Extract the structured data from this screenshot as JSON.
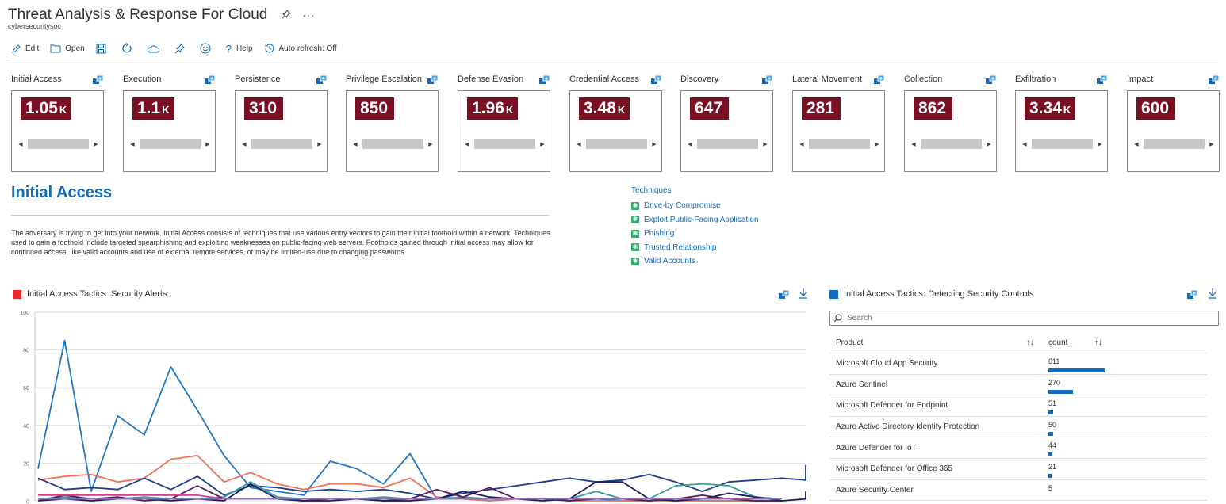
{
  "header": {
    "title": "Threat Analysis & Response For Cloud",
    "subtitle": "cybersecuritysoc",
    "more": "···"
  },
  "toolbar": {
    "edit": "Edit",
    "open": "Open",
    "help": "Help",
    "auto_refresh": "Auto refresh: Off"
  },
  "tiles": [
    {
      "label": "Initial Access",
      "value": "1.05",
      "suffix": "K"
    },
    {
      "label": "Execution",
      "value": "1.1",
      "suffix": "K"
    },
    {
      "label": "Persistence",
      "value": "310",
      "suffix": ""
    },
    {
      "label": "Privilege Escalation",
      "value": "850",
      "suffix": ""
    },
    {
      "label": "Defense Evasion",
      "value": "1.96",
      "suffix": "K"
    },
    {
      "label": "Credential Access",
      "value": "3.48",
      "suffix": "K"
    },
    {
      "label": "Discovery",
      "value": "647",
      "suffix": ""
    },
    {
      "label": "Lateral Movement",
      "value": "281",
      "suffix": ""
    },
    {
      "label": "Collection",
      "value": "862",
      "suffix": ""
    },
    {
      "label": "Exfiltration",
      "value": "3.34",
      "suffix": "K"
    },
    {
      "label": "Impact",
      "value": "600",
      "suffix": ""
    }
  ],
  "section": {
    "title": "Initial Access",
    "description": "The adversary is trying to get into your network. Initial Access consists of techniques that use various entry vectors to gain their initial foothold within a network. Techniques used to gain a foothold include targeted spearphishing and exploiting weaknesses on public-facing web servers. Footholds gained through initial access may allow for continued access, like valid accounts and use of external remote services, or may be limited-use due to changing passwords."
  },
  "techniques": {
    "header": "Techniques",
    "items": [
      "Drive-by Compromise",
      "Exploit Public-Facing Application",
      "Phishing",
      "Trusted Relationship",
      "Valid Accounts"
    ]
  },
  "alerts_chart": {
    "title": "Initial Access Tactics: Security Alerts",
    "accent": "#e8292a"
  },
  "controls_table": {
    "title": "Initial Access Tactics: Detecting Security Controls",
    "accent": "#0f6cbd",
    "search_placeholder": "Search",
    "col_product": "Product",
    "col_count": "count_",
    "rows": [
      {
        "product": "Microsoft Cloud App Security",
        "count": 611
      },
      {
        "product": "Azure Sentinel",
        "count": 270
      },
      {
        "product": "Microsoft Defender for Endpoint",
        "count": 51
      },
      {
        "product": "Azure Active Directory Identity Protection",
        "count": 50
      },
      {
        "product": "Azure Defender for IoT",
        "count": 44
      },
      {
        "product": "Microsoft Defender for Office 365",
        "count": 21
      },
      {
        "product": "Azure Security Center",
        "count": 5
      }
    ]
  },
  "chart_data": {
    "type": "line",
    "ylim": [
      0,
      100
    ],
    "yticks": [
      0,
      20,
      40,
      60,
      80,
      100
    ],
    "grid": true,
    "series": [
      {
        "color": "#1f77c4",
        "values": [
          17,
          85,
          5,
          45,
          35,
          71,
          48,
          24,
          7,
          5,
          3,
          21,
          17,
          9,
          25,
          1,
          1,
          0,
          1,
          1,
          0,
          1,
          0,
          0,
          1,
          0,
          0,
          0,
          0
        ]
      },
      {
        "color": "#f07058",
        "values": [
          11,
          13,
          14,
          10,
          12,
          22,
          24,
          10,
          15,
          9,
          6,
          9,
          9,
          7,
          12,
          2,
          1,
          0,
          1,
          1,
          0,
          0,
          0,
          0,
          0,
          0,
          0,
          0,
          0
        ]
      },
      {
        "color": "#1a3f8c",
        "values": [
          12,
          6,
          7,
          6,
          12,
          6,
          13,
          3,
          8,
          7,
          5,
          6,
          5,
          6,
          4,
          1,
          4,
          6,
          8,
          10,
          12,
          10,
          11,
          14,
          10,
          5,
          10,
          11,
          12,
          11,
          19
        ]
      },
      {
        "color": "#3a9b9b",
        "values": [
          1,
          2,
          1,
          1,
          2,
          1,
          1,
          2,
          10,
          2,
          1,
          1,
          1,
          2,
          1,
          1,
          2,
          1,
          1,
          1,
          1,
          5,
          1,
          1,
          8,
          9,
          8,
          2,
          1
        ]
      },
      {
        "color": "#5a1a5a",
        "values": [
          0,
          3,
          1,
          2,
          0,
          1,
          8,
          1,
          1,
          1,
          0,
          1,
          1,
          0,
          1,
          6,
          2,
          7,
          1,
          1,
          0,
          1,
          1,
          0,
          1,
          3,
          1,
          0,
          0
        ]
      },
      {
        "color": "#1c1c64",
        "values": [
          0,
          1,
          0,
          1,
          1,
          0,
          1,
          0,
          9,
          1,
          0,
          0,
          1,
          0,
          0,
          1,
          5,
          2,
          1,
          0,
          1,
          10,
          10,
          1,
          0,
          1,
          4,
          2,
          0,
          1,
          5
        ]
      },
      {
        "color": "#d63b8f",
        "values": [
          3,
          3,
          3,
          3,
          3,
          3,
          3,
          1,
          1,
          1,
          1,
          1,
          1,
          1,
          1,
          1,
          1,
          1,
          1,
          1,
          1,
          1,
          1,
          1,
          1,
          1,
          1,
          1,
          1
        ]
      },
      {
        "color": "#8a6fbf",
        "values": [
          1,
          1,
          1,
          1,
          1,
          1,
          1,
          1,
          1,
          1,
          1,
          1,
          1,
          1,
          1,
          1,
          1,
          1,
          1,
          1,
          1,
          1,
          1,
          1,
          1,
          1,
          1,
          1,
          1
        ]
      }
    ]
  }
}
